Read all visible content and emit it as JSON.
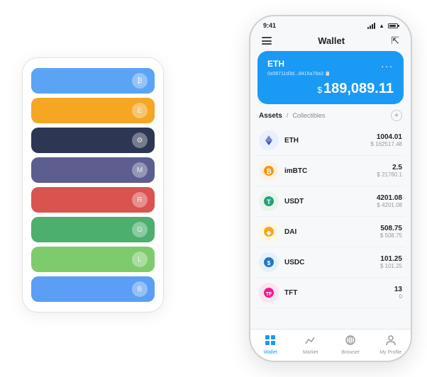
{
  "statusBar": {
    "time": "9:41"
  },
  "header": {
    "title": "Wallet",
    "menuLabel": "≡",
    "expandLabel": "⇱"
  },
  "ethCard": {
    "title": "ETH",
    "address": "0x08711d3d...8416a78a3 📋",
    "balanceSymbol": "$",
    "balance": "189,089.11",
    "moreLabel": "..."
  },
  "assets": {
    "activeTab": "Assets",
    "inactiveTab": "Collectibles",
    "divider": "/",
    "addLabel": "+"
  },
  "assetList": [
    {
      "symbol": "ETH",
      "iconEmoji": "♦",
      "iconBg": "#e8f0fe",
      "amount": "1004.01",
      "usd": "$ 162517.48"
    },
    {
      "symbol": "imBTC",
      "iconEmoji": "🔄",
      "iconBg": "#fff3e0",
      "amount": "2.5",
      "usd": "$ 21760.1"
    },
    {
      "symbol": "USDT",
      "iconEmoji": "T",
      "iconBg": "#e8f5e9",
      "amount": "4201.08",
      "usd": "$ 4201.08"
    },
    {
      "symbol": "DAI",
      "iconEmoji": "◈",
      "iconBg": "#fff8e1",
      "amount": "508.75",
      "usd": "$ 508.75"
    },
    {
      "symbol": "USDC",
      "iconEmoji": "💠",
      "iconBg": "#e3f2fd",
      "amount": "101.25",
      "usd": "$ 101.25"
    },
    {
      "symbol": "TFT",
      "iconEmoji": "🌸",
      "iconBg": "#fce4ec",
      "amount": "13",
      "usd": "0"
    }
  ],
  "bottomTabs": [
    {
      "label": "Wallet",
      "icon": "◎",
      "active": true
    },
    {
      "label": "Market",
      "icon": "📊",
      "active": false
    },
    {
      "label": "Browser",
      "icon": "🌐",
      "active": false
    },
    {
      "label": "My Profile",
      "icon": "👤",
      "active": false
    }
  ],
  "cardStack": [
    {
      "color": "#5ba4f5",
      "dotText": "₿"
    },
    {
      "color": "#f5a623",
      "dotText": "E"
    },
    {
      "color": "#2d3652",
      "dotText": "⚙"
    },
    {
      "color": "#5b5e8f",
      "dotText": "M"
    },
    {
      "color": "#d9534f",
      "dotText": "R"
    },
    {
      "color": "#4caf6e",
      "dotText": "G"
    },
    {
      "color": "#7ecb6e",
      "dotText": "L"
    },
    {
      "color": "#5b9ef5",
      "dotText": "B"
    }
  ]
}
